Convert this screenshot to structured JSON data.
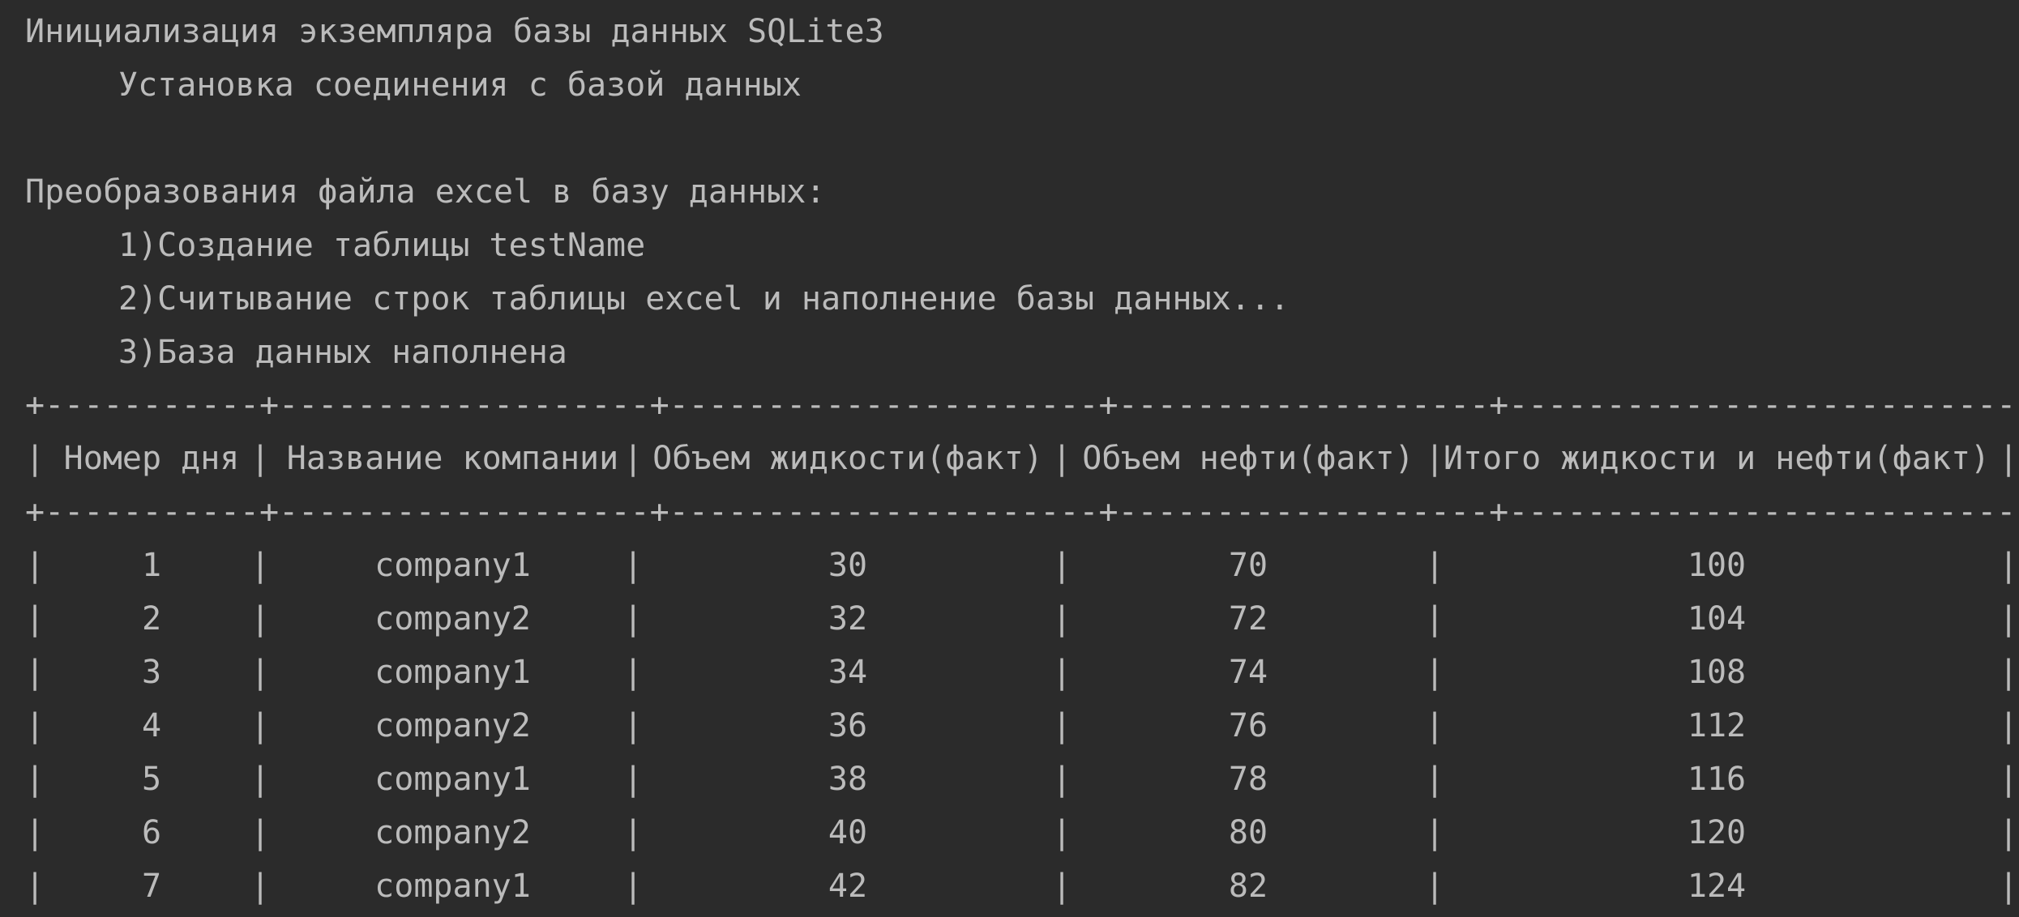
{
  "console": {
    "lines": [
      "Инициализация экземпляра базы данных SQLite3",
      "Установка соединения с базой данных",
      "Преобразования файла excel в базу данных:",
      "1)Создание таблицы testName",
      "2)Считывание строк таблицы excel и наполнение базы данных...",
      "3)База данных наполнена"
    ]
  },
  "table": {
    "border": "+-----------+-------------------+----------------------+-------------------+------------------------------+",
    "pipe": "|",
    "columns": [
      "Номер дня",
      "Название компании",
      "Объем жидкости(факт)",
      "Объем нефти(факт)",
      "Итого жидкости и нефти(факт)"
    ],
    "rows": [
      [
        "1",
        "company1",
        "30",
        "70",
        "100"
      ],
      [
        "2",
        "company2",
        "32",
        "72",
        "104"
      ],
      [
        "3",
        "company1",
        "34",
        "74",
        "108"
      ],
      [
        "4",
        "company2",
        "36",
        "76",
        "112"
      ],
      [
        "5",
        "company1",
        "38",
        "78",
        "116"
      ],
      [
        "6",
        "company2",
        "40",
        "80",
        "120"
      ],
      [
        "7",
        "company1",
        "42",
        "82",
        "124"
      ]
    ]
  },
  "colors": {
    "background": "#2b2b2b",
    "text": "#bbbbbb"
  }
}
